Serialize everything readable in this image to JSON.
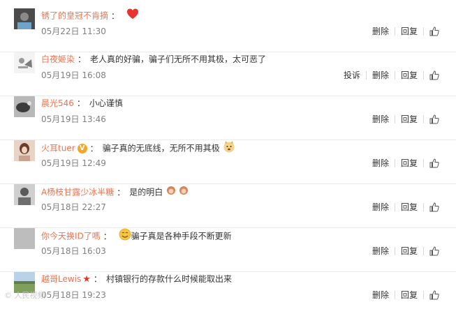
{
  "comments": [
    {
      "user": "锈了的皇冠不肯摘",
      "sep": "：",
      "text": "",
      "emoji": "heart-emoji",
      "time": "05月22日 11:30",
      "actions": [
        "删除",
        "回复"
      ],
      "avatar_color": "#5a5a5a"
    },
    {
      "user": "白夜姬染",
      "sep": "：",
      "text": "老人真的好骗，骗子们无所不用其极，太可恶了",
      "time": "05月19日 16:08",
      "actions": [
        "投诉",
        "删除",
        "回复"
      ],
      "avatar_color": "#e6e6e6"
    },
    {
      "user": "晨光546",
      "sep": "：",
      "text": "小心谨慎",
      "time": "05月19日 13:46",
      "actions": [
        "删除",
        "回复"
      ],
      "avatar_color": "#8a8a8a"
    },
    {
      "user": "火耳tuer",
      "badge": "V",
      "sep": "：",
      "text": "骗子真的无底线，无所不用其极",
      "emoji": "doge-emoji",
      "time": "05月19日 12:49",
      "actions": [
        "删除",
        "回复"
      ],
      "avatar_color": "#d8b7a3"
    },
    {
      "user": "A杨枝甘露少冰半糖",
      "sep": "：",
      "text": "是的明白",
      "emoji": "monkey-emoji",
      "time": "05月18日 22:27",
      "actions": [
        "删除",
        "回复"
      ],
      "avatar_color": "#9a9a9a"
    },
    {
      "user": "你今天换ID了嗎",
      "sep": "：",
      "text": "骗子真是各种手段不断更新",
      "emoji": "smile-emoji",
      "time": "05月18日 16:03",
      "actions": [
        "删除",
        "回复"
      ],
      "avatar_color": "#bdbdbd"
    },
    {
      "user": "越哥Lewis",
      "star": "★",
      "sep": "：",
      "text": "村镇银行的存款什么时候能取出来",
      "time": "05月18日 19:23",
      "actions": [
        "删除",
        "回复"
      ],
      "avatar_color": "#7fa05a"
    }
  ],
  "watermark": "© 人民视频"
}
